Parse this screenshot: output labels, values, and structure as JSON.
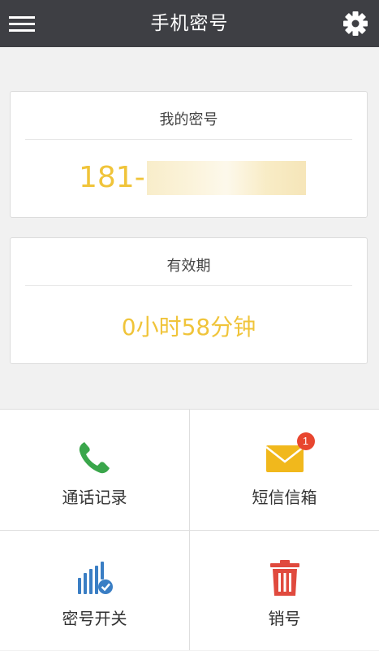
{
  "header": {
    "title": "手机密号",
    "menu_icon": "hamburger-menu-icon",
    "settings_icon": "gear-icon",
    "background": "#3e3f44"
  },
  "number_card": {
    "label": "我的密号",
    "number_prefix": "181-",
    "value_color": "#f0c43a"
  },
  "validity_card": {
    "label": "有效期",
    "value": "0小时58分钟"
  },
  "grid": {
    "items": [
      {
        "label": "通话记录",
        "icon": "phone-icon",
        "icon_color": "#3aa64b"
      },
      {
        "label": "短信信箱",
        "icon": "envelope-icon",
        "icon_color": "#f1b81c",
        "badge": "1",
        "badge_color": "#e8462f"
      },
      {
        "label": "密号开关",
        "icon": "signal-check-icon",
        "icon_color": "#3a7ec4"
      },
      {
        "label": "销号",
        "icon": "trash-icon",
        "icon_color": "#e04a3e"
      }
    ]
  }
}
